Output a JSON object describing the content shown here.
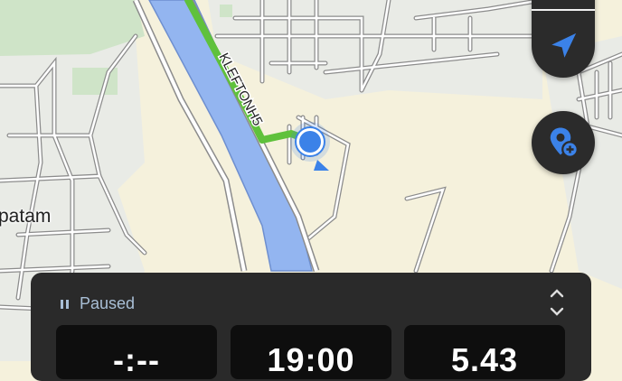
{
  "map": {
    "place_label": "patam",
    "road_label": "KLEFTONH5",
    "colors": {
      "land": "#f5f1dc",
      "urban": "#e9ebe6",
      "park": "#cfe4c8",
      "river": "#93b5f0",
      "route": "#5fc13c",
      "location": "#3b82e8"
    }
  },
  "controls": {
    "recenter_icon": "navigation-arrow-icon",
    "add_place_icon": "add-location-pin-icon"
  },
  "tracker": {
    "status_label": "Paused",
    "status_icon": "pause-icon",
    "expand_icon": "expand-collapse-icon",
    "stats": [
      "-:--",
      "19:00",
      "5.43"
    ]
  }
}
